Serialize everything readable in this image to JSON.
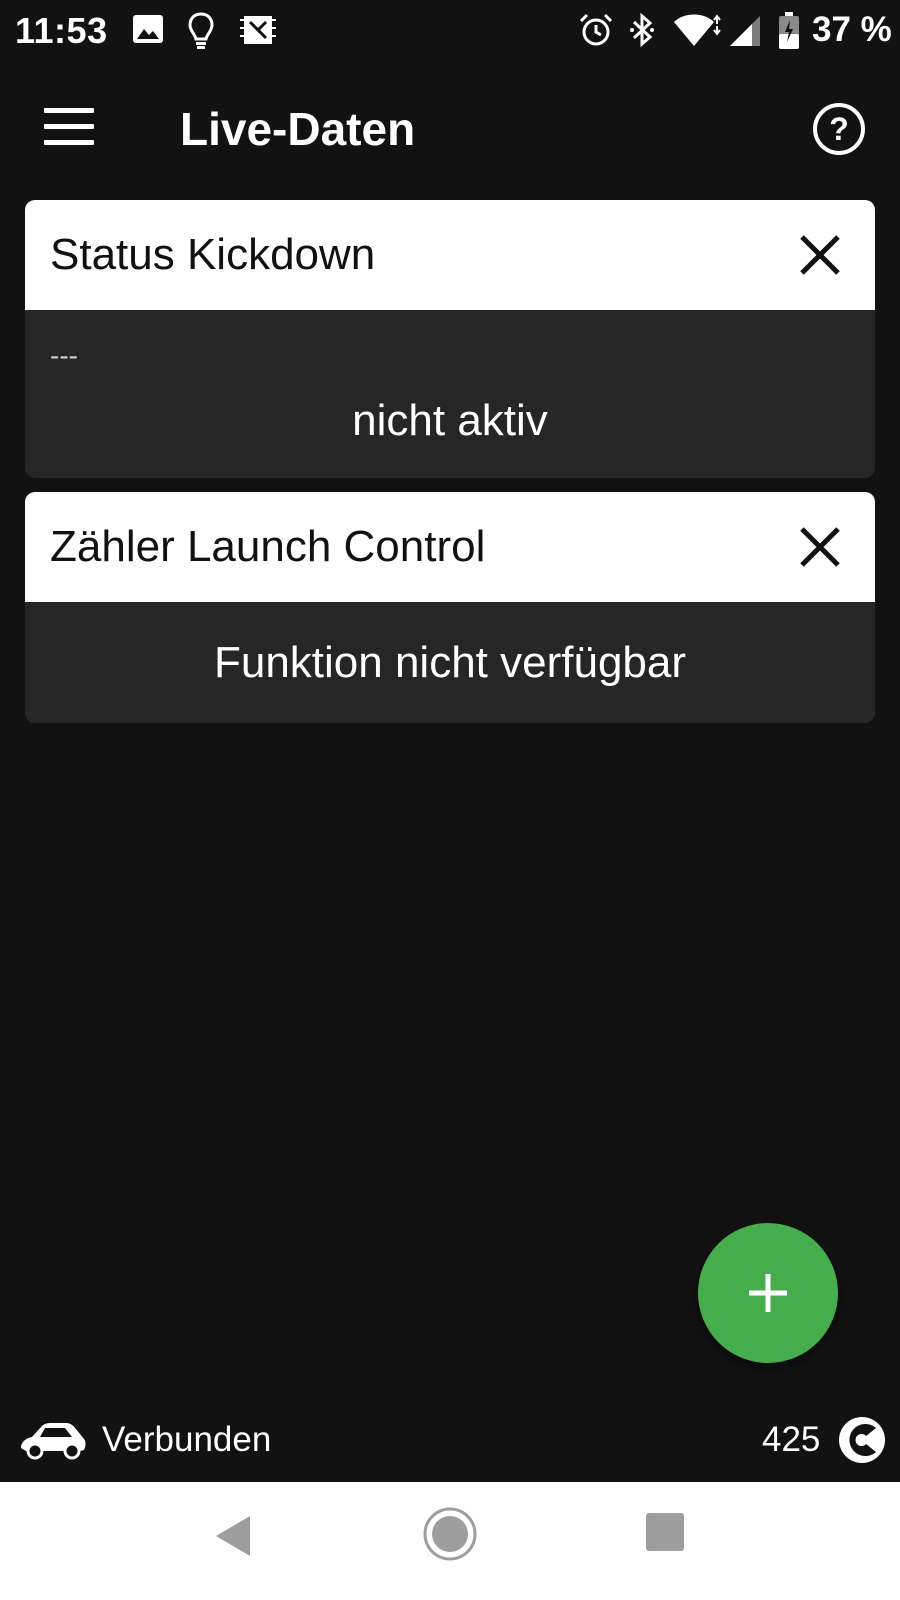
{
  "status_bar": {
    "time": "11:53",
    "battery": "37 %",
    "icons": [
      "image-icon",
      "lightbulb-icon",
      "chip-icon",
      "alarm-icon",
      "bluetooth-icon",
      "wifi-icon",
      "cell-signal-icon",
      "battery-icon"
    ]
  },
  "app_bar": {
    "title": "Live-Daten",
    "menu_icon": "hamburger-menu-icon",
    "help_icon": "help-circle-icon"
  },
  "cards": [
    {
      "title": "Status Kickdown",
      "subtitle": "---",
      "value": "nicht aktiv"
    },
    {
      "title": "Zähler Launch Control",
      "value": "Funktion nicht verfügbar"
    }
  ],
  "fab": {
    "icon": "plus-icon",
    "color": "#46ad4c"
  },
  "connection": {
    "status": "Verbunden",
    "count": "425",
    "car_icon": "car-icon",
    "logo_icon": "app-logo-icon"
  },
  "nav": [
    "back-icon",
    "home-icon",
    "recents-icon"
  ],
  "colors": {
    "background": "#121212",
    "card_header": "#ffffff",
    "card_body": "#262626",
    "accent": "#46ad4c"
  }
}
